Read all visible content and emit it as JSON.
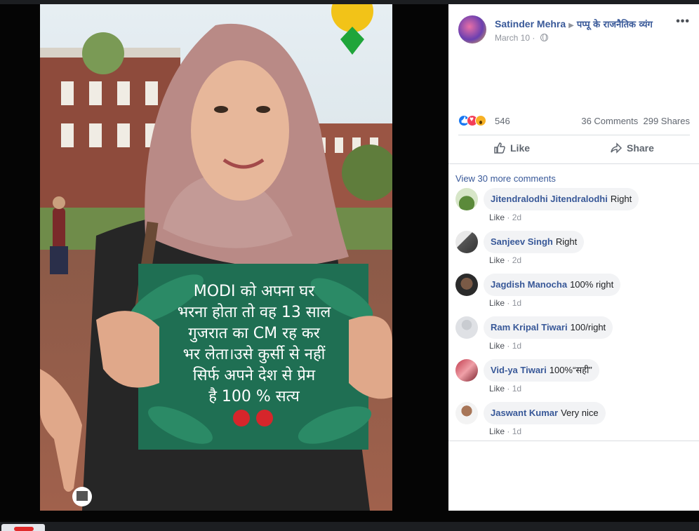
{
  "photo": {
    "sign_lines": [
      "MODI को अपना घर",
      "भरना होता तो वह 13 साल",
      "गुजरात का CM रह कर",
      "भर लेता।उसे कुर्सी से नहीं",
      "सिर्फ अपने देश से प्रेम",
      "है 100 % सत्य"
    ]
  },
  "post": {
    "author": "Satinder Mehra",
    "group": "पप्पू के राजनैतिक व्यंग",
    "date": "March 10",
    "reaction_count": "546",
    "comments_count": "36 Comments",
    "shares_count": "299 Shares",
    "like_label": "Like",
    "share_label": "Share"
  },
  "comments_section": {
    "view_more": "View 30 more comments",
    "items": [
      {
        "name": "Jitendralodhi Jitendralodhi",
        "text": "Right",
        "like": "Like",
        "time": "2d"
      },
      {
        "name": "Sanjeev Singh",
        "text": "Right",
        "like": "Like",
        "time": "2d"
      },
      {
        "name": "Jagdish Manocha",
        "text": "100% right",
        "like": "Like",
        "time": "1d"
      },
      {
        "name": "Ram Kripal Tiwari",
        "text": "100/right",
        "like": "Like",
        "time": "1d"
      },
      {
        "name": "Vid-ya Tiwari",
        "text": "100%“सही”",
        "like": "Like",
        "time": "1d"
      },
      {
        "name": "Jaswant Kumar",
        "text": "Very nice",
        "like": "Like",
        "time": "1d"
      }
    ]
  },
  "colors": {
    "link_blue": "#385898",
    "bubble_bg": "#f2f3f5",
    "sign_green": "#1f6f53"
  },
  "icons": [
    "globe-icon",
    "more-icon",
    "like-icon",
    "share-icon",
    "bjp-logo"
  ]
}
